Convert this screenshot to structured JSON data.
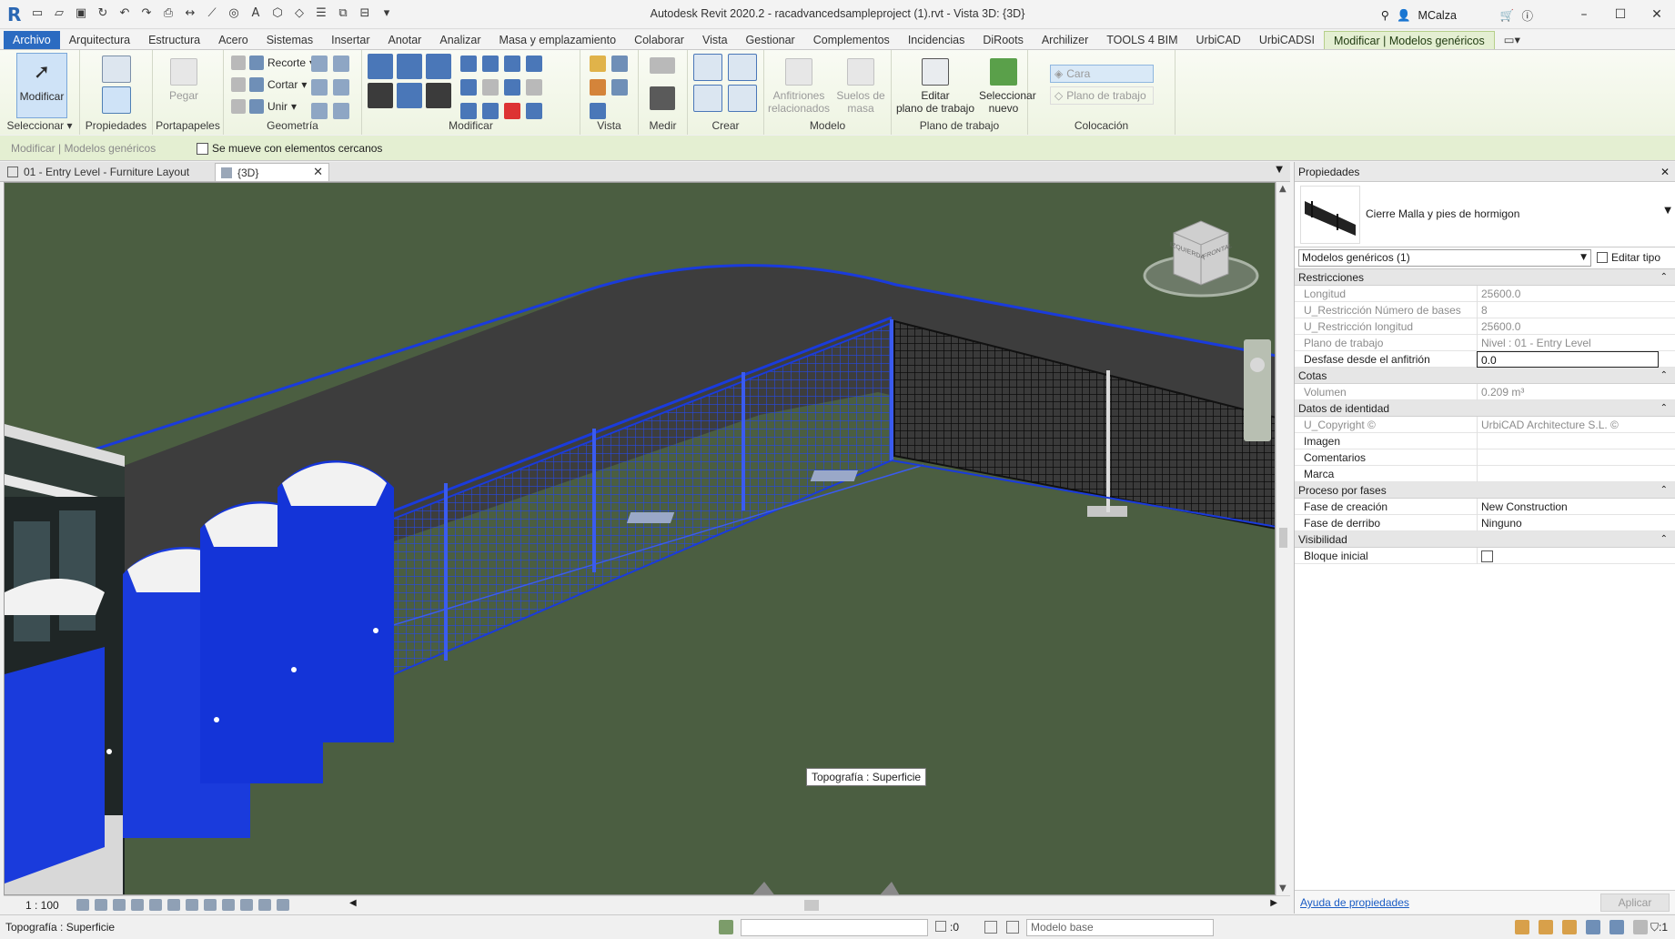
{
  "app": {
    "title": "Autodesk Revit 2020.2 - racadvancedsampleproject (1).rvt - Vista 3D: {3D}",
    "user": "MCalza"
  },
  "ribbon_tabs": [
    "Archivo",
    "Arquitectura",
    "Estructura",
    "Acero",
    "Sistemas",
    "Insertar",
    "Anotar",
    "Analizar",
    "Masa y emplazamiento",
    "Colaborar",
    "Vista",
    "Gestionar",
    "Complementos",
    "Incidencias",
    "DiRoots",
    "Archilizer",
    "TOOLS 4 BIM",
    "UrbiCAD",
    "UrbiCADSI",
    "Modificar | Modelos genéricos"
  ],
  "ribbon": {
    "modificar": "Modificar",
    "seleccionar": "Seleccionar",
    "propiedades": "Propiedades",
    "pegar": "Pegar",
    "portapapeles": "Portapapeles",
    "recorte": "Recorte",
    "cortar": "Cortar",
    "unir": "Unir",
    "geometria": "Geometría",
    "modificar_panel": "Modificar",
    "vista": "Vista",
    "medir": "Medir",
    "crear": "Crear",
    "anfitriones_1": "Anfitriones",
    "anfitriones_2": "relacionados",
    "suelos_1": "Suelos de",
    "suelos_2": "masa",
    "modelo": "Modelo",
    "editar_1": "Editar",
    "editar_2": "plano de trabajo",
    "plano_trabajo_panel": "Plano de trabajo",
    "selnuevo_1": "Seleccionar",
    "selnuevo_2": "nuevo",
    "cara": "Cara",
    "plano_trabajo": "Plano de trabajo",
    "colocacion": "Colocación"
  },
  "options_bar": {
    "context": "Modificar | Modelos genéricos",
    "checkbox_label": "Se mueve con elementos cercanos"
  },
  "view_tabs": [
    {
      "label": "01 - Entry Level - Furniture Layout"
    },
    {
      "label": "{3D}"
    }
  ],
  "canvas": {
    "tooltip": "Topografía : Superficie",
    "viewcube_front": "FRONTAL",
    "viewcube_left": "IZQUIERDA"
  },
  "view_control": {
    "scale": "1 : 100"
  },
  "properties": {
    "header": "Propiedades",
    "type_name": "Cierre Malla y pies de hormigon",
    "instance_filter": "Modelos genéricos (1)",
    "edit_type": "Editar tipo",
    "groups": [
      {
        "name": "Restricciones",
        "rows": [
          {
            "k": "Longitud",
            "v": "25600.0",
            "ro": true
          },
          {
            "k": "U_Restricción Número de bases",
            "v": "8",
            "ro": true
          },
          {
            "k": "U_Restricción longitud",
            "v": "25600.0",
            "ro": true
          },
          {
            "k": "Plano de trabajo",
            "v": "Nivel : 01 - Entry Level",
            "ro": true
          },
          {
            "k": "Desfase desde el anfitrión",
            "v": "0.0",
            "ro": false,
            "edit": true
          }
        ]
      },
      {
        "name": "Cotas",
        "rows": [
          {
            "k": "Volumen",
            "v": "0.209 m³",
            "ro": true
          }
        ]
      },
      {
        "name": "Datos de identidad",
        "rows": [
          {
            "k": "U_Copyright ©",
            "v": "UrbiCAD Architecture S.L. ©",
            "ro": true
          },
          {
            "k": "Imagen",
            "v": "",
            "ro": false
          },
          {
            "k": "Comentarios",
            "v": "",
            "ro": false
          },
          {
            "k": "Marca",
            "v": "",
            "ro": false
          }
        ]
      },
      {
        "name": "Proceso por fases",
        "rows": [
          {
            "k": "Fase de creación",
            "v": "New Construction",
            "ro": false
          },
          {
            "k": "Fase de derribo",
            "v": "Ninguno",
            "ro": false
          }
        ]
      },
      {
        "name": "Visibilidad",
        "rows": [
          {
            "k": "Bloque inicial",
            "v": "",
            "ro": false,
            "checkbox": true
          }
        ]
      }
    ],
    "help_link": "Ayuda de propiedades",
    "apply": "Aplicar"
  },
  "status_bar": {
    "text": "Topografía : Superficie",
    "zero": ":0",
    "model": "Modelo base",
    "filter": ":1"
  },
  "colors": {
    "accent": "#2b6bc1",
    "context_tab": "#e4efd2",
    "selection_blue": "#1a3bdc",
    "terrain": "#4b5e41",
    "road": "#3c3c3c"
  }
}
